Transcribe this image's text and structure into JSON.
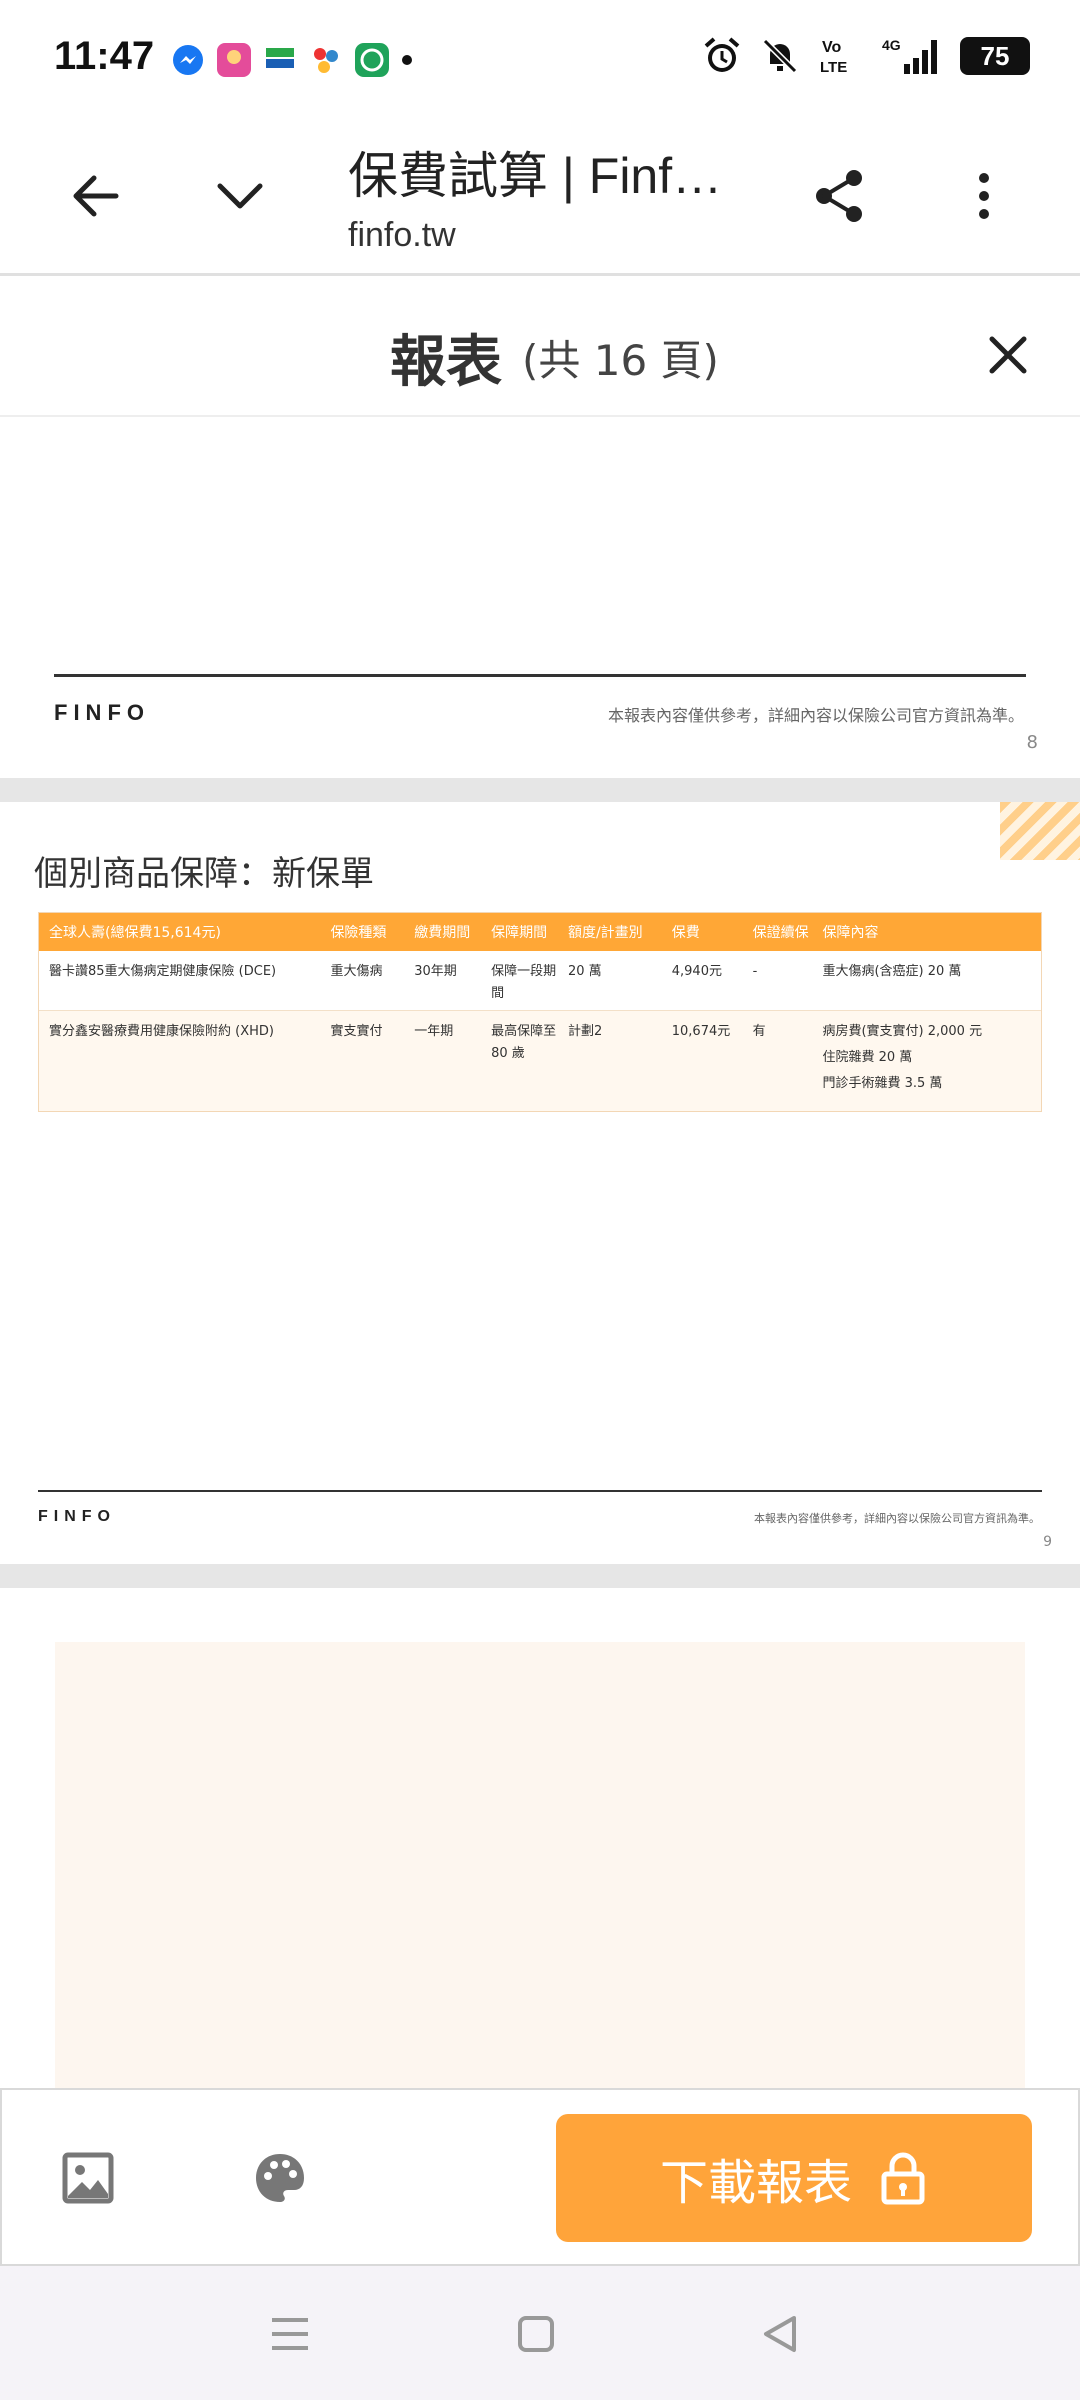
{
  "status": {
    "time": "11:47",
    "battery": "75",
    "net_label": "4G",
    "volte": "Vo LTE"
  },
  "browser": {
    "title": "保費試算 | Finfo...",
    "url": "finfo.tw"
  },
  "report": {
    "title": "報表",
    "pages": "(共 16 頁)"
  },
  "page8": {
    "logo": "FINFO",
    "disclaimer": "本報表內容僅供參考，詳細內容以保險公司官方資訊為準。",
    "number": "8"
  },
  "page9": {
    "section_title": "個別商品保障：新保單",
    "table": {
      "headers": [
        "全球人壽(總保費15,614元)",
        "保險種類",
        "繳費期間",
        "保障期間",
        "額度/計畫別",
        "保費",
        "保證續保",
        "保障內容"
      ],
      "rows": [
        [
          "醫卡讚85重大傷病定期健康保險 (DCE)",
          "重大傷病",
          "30年期",
          "保障一段期間",
          "20 萬",
          "4,940元",
          "-",
          "重大傷病(含癌症) 20 萬"
        ],
        [
          "實分鑫安醫療費用健康保險附約 (XHD)",
          "實支實付",
          "一年期",
          "最高保障至 80 歲",
          "計劃2",
          "10,674元",
          "有",
          "病房費(實支實付) 2,000 元",
          "住院雜費 20 萬",
          "門診手術雜費 3.5 萬"
        ]
      ]
    },
    "logo": "FINFO",
    "disclaimer": "本報表內容僅供參考，詳細內容以保險公司官方資訊為準。",
    "number": "9"
  },
  "actions": {
    "download_label": "下載報表"
  },
  "colors": {
    "accent": "#ffa43a",
    "table_header": "#ffa736"
  }
}
